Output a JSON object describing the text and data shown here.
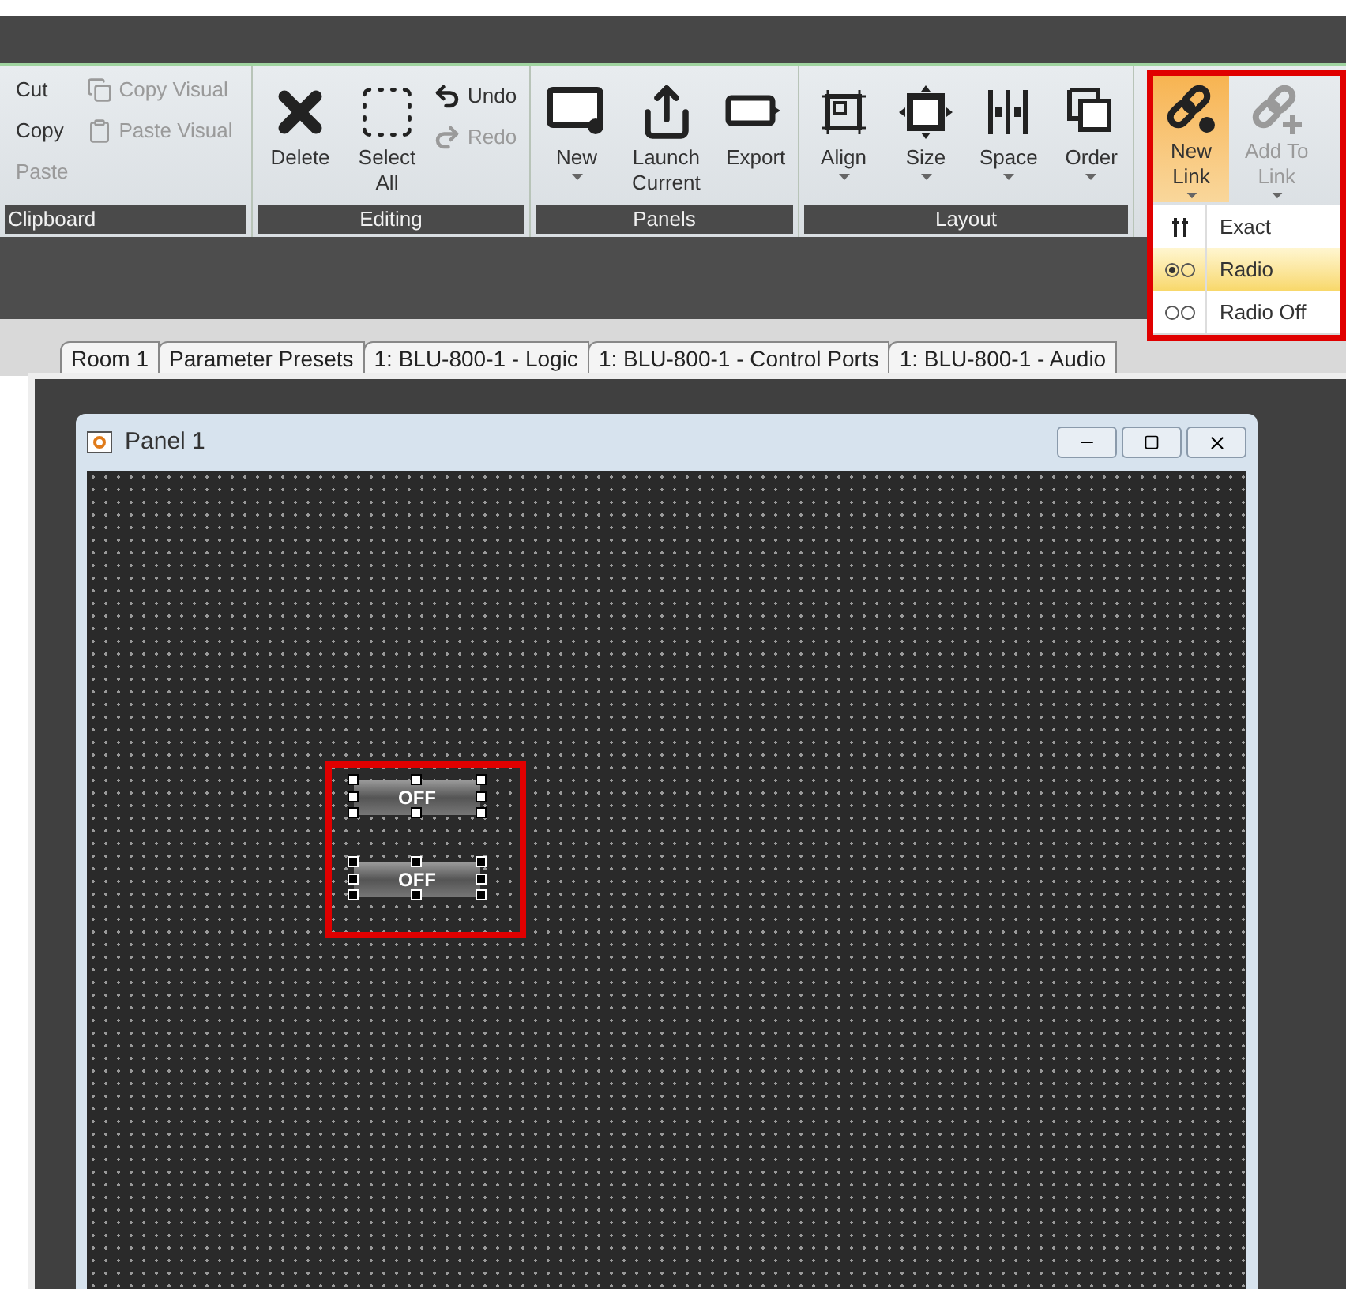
{
  "ribbon": {
    "groups": [
      {
        "label": "Clipboard",
        "items": [
          {
            "label": "Cut",
            "kind": "small",
            "disabled": false
          },
          {
            "label": "Copy",
            "kind": "small",
            "disabled": false
          },
          {
            "label": "Paste",
            "kind": "small",
            "disabled": true
          },
          {
            "label": "Copy Visual",
            "kind": "small",
            "disabled": true
          },
          {
            "label": "Paste Visual",
            "kind": "small",
            "disabled": true
          }
        ]
      },
      {
        "label": "Editing",
        "items": [
          {
            "label": "Delete",
            "kind": "large",
            "disabled": false
          },
          {
            "label": "Select\nAll",
            "kind": "large",
            "disabled": false
          },
          {
            "label": "Undo",
            "kind": "small",
            "disabled": false
          },
          {
            "label": "Redo",
            "kind": "small",
            "disabled": true
          }
        ]
      },
      {
        "label": "Panels",
        "items": [
          {
            "label": "New",
            "kind": "large",
            "dropdown": true,
            "disabled": false
          },
          {
            "label": "Launch\nCurrent",
            "kind": "large",
            "dropdown": false,
            "disabled": false
          },
          {
            "label": "Export",
            "kind": "large",
            "dropdown": false,
            "disabled": false
          }
        ]
      },
      {
        "label": "Layout",
        "items": [
          {
            "label": "Align",
            "kind": "large",
            "dropdown": true,
            "disabled": false
          },
          {
            "label": "Size",
            "kind": "large",
            "dropdown": true,
            "disabled": false
          },
          {
            "label": "Space",
            "kind": "large",
            "dropdown": true,
            "disabled": false
          },
          {
            "label": "Order",
            "kind": "large",
            "dropdown": true,
            "disabled": false
          }
        ]
      },
      {
        "items": [
          {
            "label": "New\nLink",
            "kind": "large",
            "dropdown": true,
            "active": true,
            "disabled": false
          },
          {
            "label": "Add To\nLink",
            "kind": "large",
            "dropdown": true,
            "active": false,
            "disabled": true
          }
        ]
      }
    ]
  },
  "link_menu": [
    {
      "label": "Exact",
      "selected": false
    },
    {
      "label": "Radio",
      "selected": true
    },
    {
      "label": "Radio Off",
      "selected": false
    }
  ],
  "tabs": [
    {
      "label": "Room 1"
    },
    {
      "label": "Parameter Presets"
    },
    {
      "label": "1: BLU-800-1 - Logic"
    },
    {
      "label": "1: BLU-800-1 - Control Ports"
    },
    {
      "label": "1: BLU-800-1 - Audio"
    }
  ],
  "panel": {
    "title": "Panel 1",
    "controls": [
      {
        "label": "OFF",
        "kind": "primary"
      },
      {
        "label": "OFF",
        "kind": "secondary"
      }
    ]
  }
}
